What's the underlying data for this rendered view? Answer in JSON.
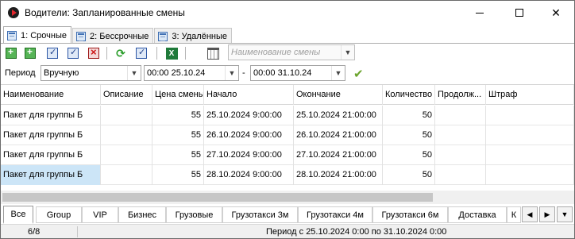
{
  "window": {
    "title": "Водители: Запланированные смены"
  },
  "tabs": [
    {
      "label": "1: Срочные"
    },
    {
      "label": "2: Бессрочные"
    },
    {
      "label": "3: Удалённые"
    }
  ],
  "toolbar": {
    "name_filter_placeholder": "Наименование смены"
  },
  "filter": {
    "period_label": "Период",
    "mode_value": "Вручную",
    "from_value": "00:00 25.10.24",
    "dash": "-",
    "to_value": "00:00 31.10.24"
  },
  "grid": {
    "columns": [
      "Наименование",
      "Описание",
      "Цена смены",
      "Начало",
      "Окончание",
      "Количество",
      "Продолж...",
      "Штраф"
    ],
    "rows": [
      {
        "name": "Пакет для группы Б",
        "desc": "",
        "price": "55",
        "start": "25.10.2024 9:00:00",
        "end": "25.10.2024 21:00:00",
        "qty": "50",
        "dur": "",
        "fine": ""
      },
      {
        "name": "Пакет для группы Б",
        "desc": "",
        "price": "55",
        "start": "26.10.2024 9:00:00",
        "end": "26.10.2024 21:00:00",
        "qty": "50",
        "dur": "",
        "fine": ""
      },
      {
        "name": "Пакет для группы Б",
        "desc": "",
        "price": "55",
        "start": "27.10.2024 9:00:00",
        "end": "27.10.2024 21:00:00",
        "qty": "50",
        "dur": "",
        "fine": ""
      },
      {
        "name": "Пакет для группы Б",
        "desc": "",
        "price": "55",
        "start": "28.10.2024 9:00:00",
        "end": "28.10.2024 21:00:00",
        "qty": "50",
        "dur": "",
        "fine": ""
      }
    ]
  },
  "groups": [
    "Все",
    "Group",
    "VIP",
    "Бизнес",
    "Грузовые",
    "Грузотакси 3м",
    "Грузотакси 4м",
    "Грузотакси 6м",
    "Доставка",
    "К"
  ],
  "status": {
    "count": "6/8",
    "period": "Период с 25.10.2024 0:00 по 31.10.2024 0:00"
  },
  "icons": {
    "add": "add-icon",
    "copy": "copy-icon",
    "edit": "edit-icon",
    "edit_multiple": "edit-multiple-icon",
    "delete": "delete-icon",
    "refresh": "refresh-icon",
    "properties": "properties-icon",
    "excel": "excel-icon",
    "calendar": "calendar-icon",
    "apply": "checkmark-icon"
  }
}
